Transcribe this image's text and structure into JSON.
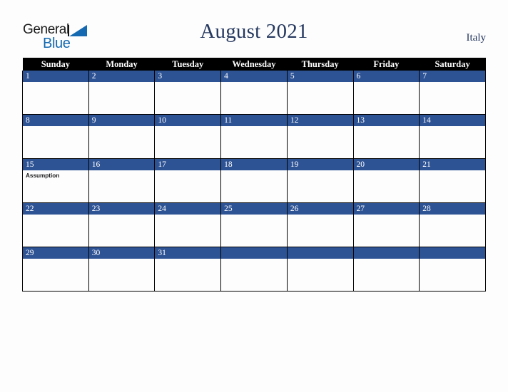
{
  "brand": {
    "word_one": "General",
    "word_two": "Blue",
    "triangle_icon": "triangle-icon",
    "accent_color": "#1569b0"
  },
  "header": {
    "title": "August 2021",
    "country": "Italy"
  },
  "colors": {
    "header_row_bg": "#000000",
    "date_band_bg": "#2e5395",
    "title_text": "#24375e",
    "page_bg": "#fdfdfd",
    "grid_line": "#000000"
  },
  "calendar": {
    "weekday_headers": [
      "Sunday",
      "Monday",
      "Tuesday",
      "Wednesday",
      "Thursday",
      "Friday",
      "Saturday"
    ],
    "weeks": [
      [
        {
          "day": "1",
          "events": []
        },
        {
          "day": "2",
          "events": []
        },
        {
          "day": "3",
          "events": []
        },
        {
          "day": "4",
          "events": []
        },
        {
          "day": "5",
          "events": []
        },
        {
          "day": "6",
          "events": []
        },
        {
          "day": "7",
          "events": []
        }
      ],
      [
        {
          "day": "8",
          "events": []
        },
        {
          "day": "9",
          "events": []
        },
        {
          "day": "10",
          "events": []
        },
        {
          "day": "11",
          "events": []
        },
        {
          "day": "12",
          "events": []
        },
        {
          "day": "13",
          "events": []
        },
        {
          "day": "14",
          "events": []
        }
      ],
      [
        {
          "day": "15",
          "events": [
            "Assumption"
          ]
        },
        {
          "day": "16",
          "events": []
        },
        {
          "day": "17",
          "events": []
        },
        {
          "day": "18",
          "events": []
        },
        {
          "day": "19",
          "events": []
        },
        {
          "day": "20",
          "events": []
        },
        {
          "day": "21",
          "events": []
        }
      ],
      [
        {
          "day": "22",
          "events": []
        },
        {
          "day": "23",
          "events": []
        },
        {
          "day": "24",
          "events": []
        },
        {
          "day": "25",
          "events": []
        },
        {
          "day": "26",
          "events": []
        },
        {
          "day": "27",
          "events": []
        },
        {
          "day": "28",
          "events": []
        }
      ],
      [
        {
          "day": "29",
          "events": []
        },
        {
          "day": "30",
          "events": []
        },
        {
          "day": "31",
          "events": []
        },
        {
          "day": "",
          "events": []
        },
        {
          "day": "",
          "events": []
        },
        {
          "day": "",
          "events": []
        },
        {
          "day": "",
          "events": []
        }
      ]
    ]
  }
}
